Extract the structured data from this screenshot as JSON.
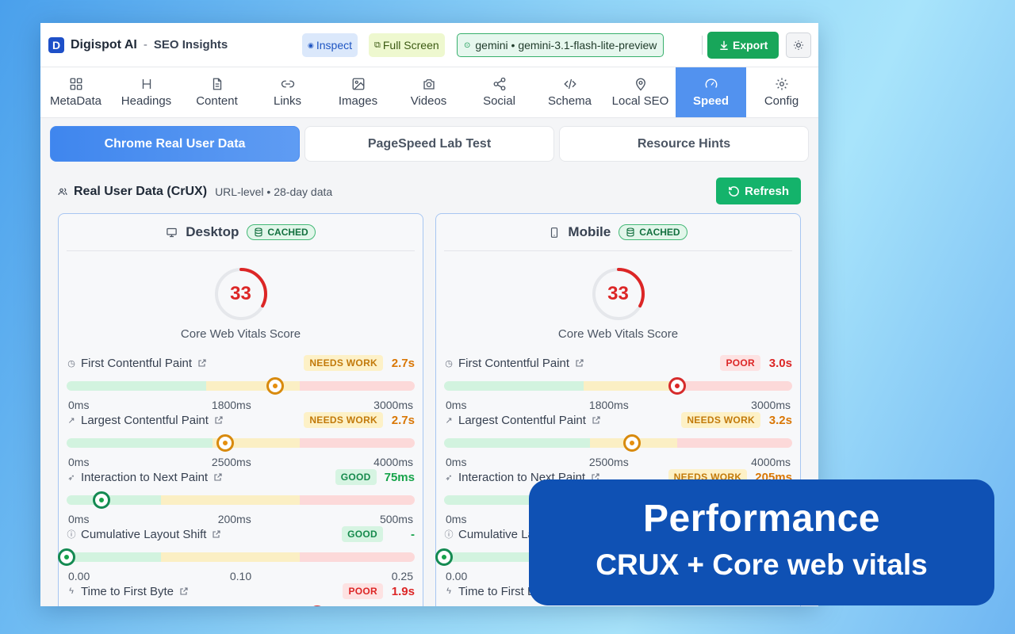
{
  "header": {
    "logo_letter": "D",
    "brand": "Digispot AI",
    "separator": "-",
    "subtitle": "SEO Insights",
    "inspect_label": "Inspect",
    "fullscreen_label": "Full Screen",
    "model_label": "gemini • gemini-3.1-flash-lite-preview",
    "export_label": "Export"
  },
  "tabs": [
    {
      "label": "MetaData",
      "icon": "grid-icon"
    },
    {
      "label": "Headings",
      "icon": "heading-icon"
    },
    {
      "label": "Content",
      "icon": "document-icon"
    },
    {
      "label": "Links",
      "icon": "link-icon"
    },
    {
      "label": "Images",
      "icon": "image-icon"
    },
    {
      "label": "Videos",
      "icon": "camera-icon"
    },
    {
      "label": "Social",
      "icon": "share-icon"
    },
    {
      "label": "Schema",
      "icon": "code-icon"
    },
    {
      "label": "Local SEO",
      "icon": "map-pin-icon"
    },
    {
      "label": "Speed",
      "icon": "gauge-icon",
      "active": true
    },
    {
      "label": "Config",
      "icon": "gear-icon"
    }
  ],
  "subtabs": [
    "Chrome Real User Data",
    "PageSpeed Lab Test",
    "Resource Hints"
  ],
  "section": {
    "title": "Real User Data (CrUX)",
    "meta": "URL-level • 28-day data",
    "refresh_label": "Refresh"
  },
  "desktop": {
    "title": "Desktop",
    "cached": "CACHED",
    "score": "33",
    "score_label": "Core Web Vitals Score",
    "metrics": [
      {
        "name": "First Contentful Paint",
        "badge": "NEEDS WORK",
        "value": "2.7s",
        "ticks": [
          "0ms",
          "1800ms",
          "3000ms"
        ]
      },
      {
        "name": "Largest Contentful Paint",
        "badge": "NEEDS WORK",
        "value": "2.7s",
        "ticks": [
          "0ms",
          "2500ms",
          "4000ms"
        ]
      },
      {
        "name": "Interaction to Next Paint",
        "badge": "GOOD",
        "value": "75ms",
        "ticks": [
          "0ms",
          "200ms",
          "500ms"
        ]
      },
      {
        "name": "Cumulative Layout Shift",
        "badge": "GOOD",
        "value": "-",
        "ticks": [
          "0.00",
          "0.10",
          "0.25"
        ]
      },
      {
        "name": "Time to First Byte",
        "badge": "POOR",
        "value": "1.9s"
      }
    ]
  },
  "mobile": {
    "title": "Mobile",
    "cached": "CACHED",
    "score": "33",
    "score_label": "Core Web Vitals Score",
    "metrics": [
      {
        "name": "First Contentful Paint",
        "badge": "POOR",
        "value": "3.0s",
        "ticks": [
          "0ms",
          "1800ms",
          "3000ms"
        ]
      },
      {
        "name": "Largest Contentful Paint",
        "badge": "NEEDS WORK",
        "value": "3.2s",
        "ticks": [
          "0ms",
          "2500ms",
          "4000ms"
        ]
      },
      {
        "name": "Interaction to Next Paint",
        "badge": "NEEDS WORK",
        "value": "205ms",
        "ticks": [
          "0ms"
        ]
      },
      {
        "name": "Cumulative Layout Shift",
        "ticks": [
          "0.00"
        ]
      },
      {
        "name": "Time to First Byte"
      }
    ]
  },
  "overlay": {
    "title": "Performance",
    "subtitle": "CRUX + Core web vitals"
  },
  "colors": {
    "accent": "#5292ef",
    "good": "#16a34a",
    "needs_work": "#d97706",
    "poor": "#dc2626",
    "overlay_bg": "#0f51b4"
  }
}
